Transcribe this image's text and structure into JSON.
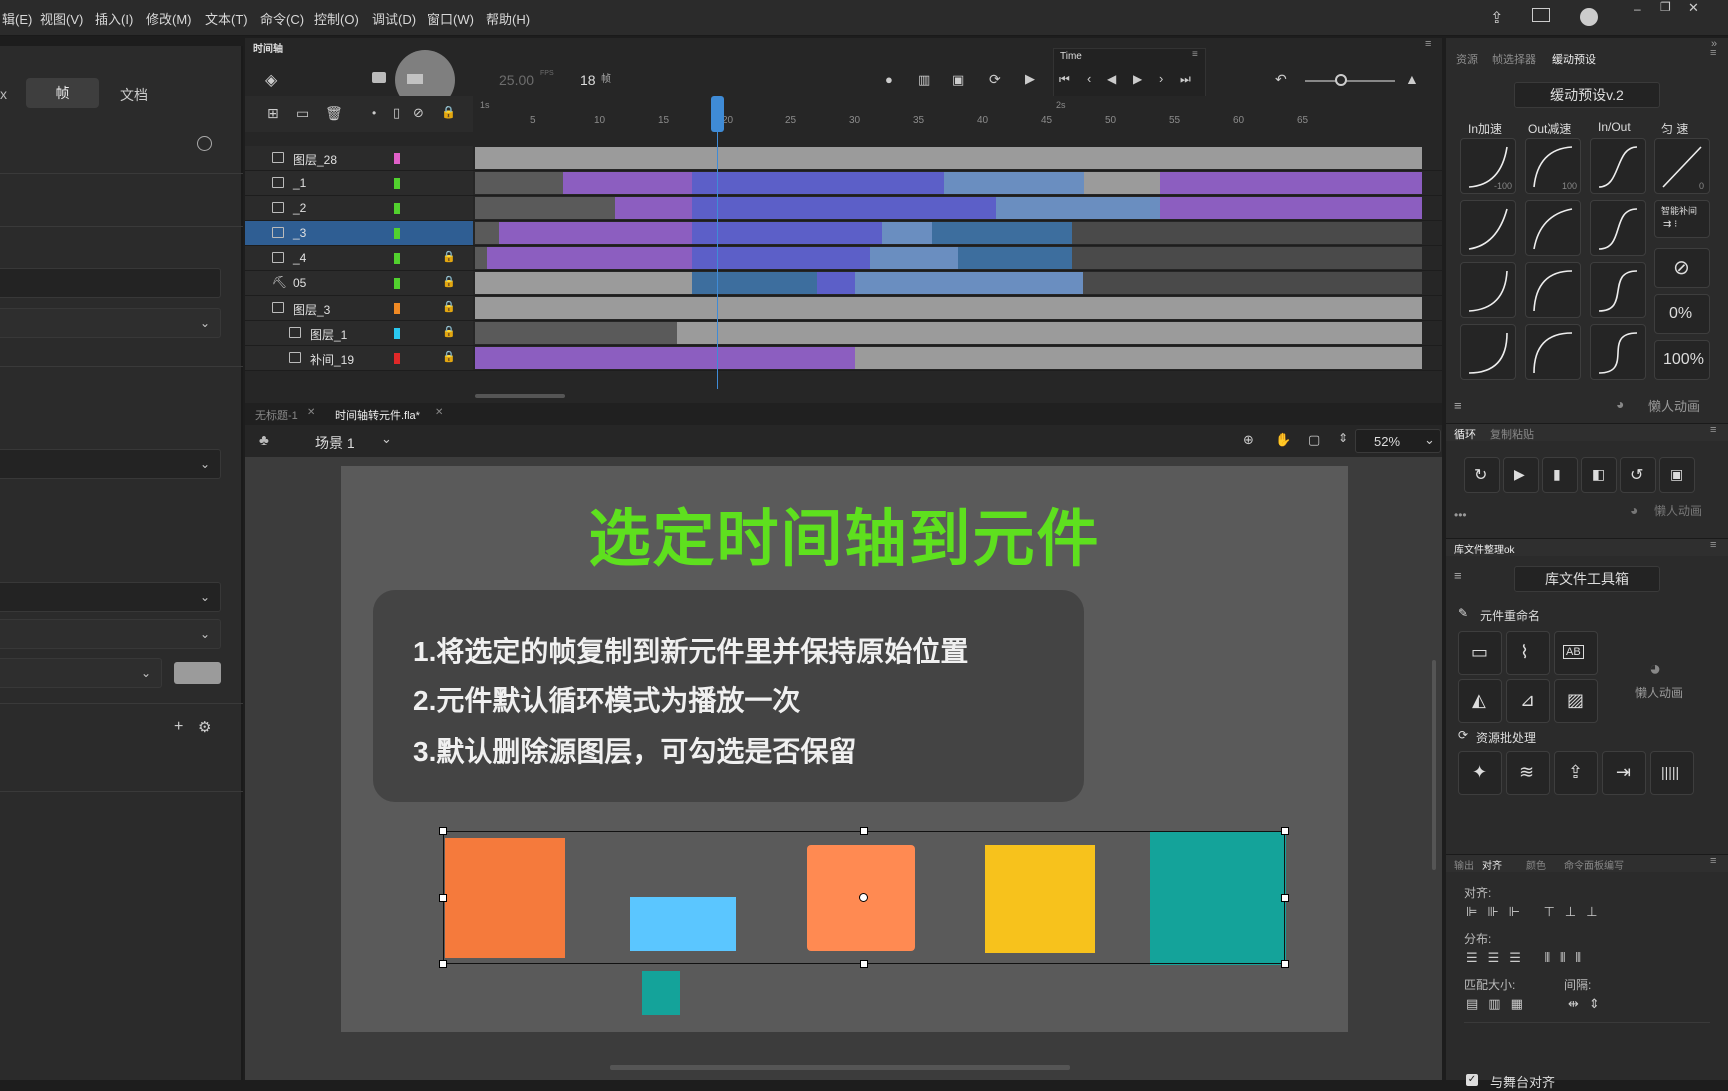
{
  "menubar": {
    "items": [
      "辑(E)",
      "视图(V)",
      "插入(I)",
      "修改(M)",
      "文本(T)",
      "命令(C)",
      "控制(O)",
      "调试(D)",
      "窗口(W)",
      "帮助(H)"
    ]
  },
  "left_panel": {
    "tab_edge": "x",
    "tabs": [
      "帧",
      "文档"
    ]
  },
  "timeline": {
    "title": "时间轴",
    "fps": "25.00",
    "fps_unit": "FPS",
    "frame": "18",
    "frame_unit": "帧",
    "time_panel_title": "Time",
    "ruler_ticks": [
      "5",
      "10",
      "15",
      "20",
      "25",
      "30",
      "35",
      "40",
      "45",
      "50",
      "55",
      "60",
      "65"
    ],
    "ruler_seconds": [
      "1s",
      "2s"
    ],
    "layers": [
      {
        "name": "图层_28",
        "color": "#e060c8",
        "locked": false
      },
      {
        "name": "_1",
        "color": "#52d12e",
        "locked": false
      },
      {
        "name": "_2",
        "color": "#52d12e",
        "locked": false
      },
      {
        "name": "_3",
        "color": "#52d12e",
        "locked": false,
        "selected": true
      },
      {
        "name": "_4",
        "color": "#52d12e",
        "locked": true
      },
      {
        "name": "05",
        "color": "#52d12e",
        "locked": true
      },
      {
        "name": "图层_3",
        "color": "#f08a24",
        "locked": true
      },
      {
        "name": "图层_1",
        "color": "#2ac8f0",
        "locked": true
      },
      {
        "name": "补间_19",
        "color": "#e02828",
        "locked": true
      }
    ]
  },
  "doc_tabs": [
    "无标题-1",
    "时间轴转元件.fla*"
  ],
  "stage_bar": {
    "scene": "场景 1",
    "zoom": "52%"
  },
  "stage": {
    "title": "选定时间轴到元件",
    "lines": [
      "1.将选定的帧复制到新元件里并保持原始位置",
      "2.元件默认循环模式为播放一次",
      "3.默认删除源图层，可勾选是否保留"
    ],
    "colors": {
      "title": "#5ee01e",
      "orange": "#f57a3c",
      "blue": "#5bc6ff",
      "salmon": "#ff8a52",
      "yellow": "#f7c21c",
      "teal": "#14a39a"
    }
  },
  "right_panel": {
    "tabs": [
      "资源",
      "帧选择器",
      "缓动预设"
    ],
    "preset_title": "缓动预设v.2",
    "columns": [
      "In加速",
      "Out减速",
      "In/Out",
      "匀 速"
    ],
    "curve_labels": [
      "-100",
      "100",
      "0"
    ],
    "smart_label": "智能补间",
    "pct0": "0%",
    "pct100": "100%",
    "brand": "懒人动画",
    "loop_tabs": [
      "循环",
      "复制粘贴"
    ],
    "lib_header": "库文件整理ok",
    "lib_title": "库文件工具箱",
    "rename_label": "元件重命名",
    "batch_label": "资源批处理",
    "align_tabs": [
      "输出",
      "对齐",
      "颜色",
      "命令面板编写"
    ],
    "align_labels": [
      "对齐:",
      "分布:",
      "匹配大小:",
      "间隔:"
    ],
    "stage_align": "与舞台对齐"
  }
}
